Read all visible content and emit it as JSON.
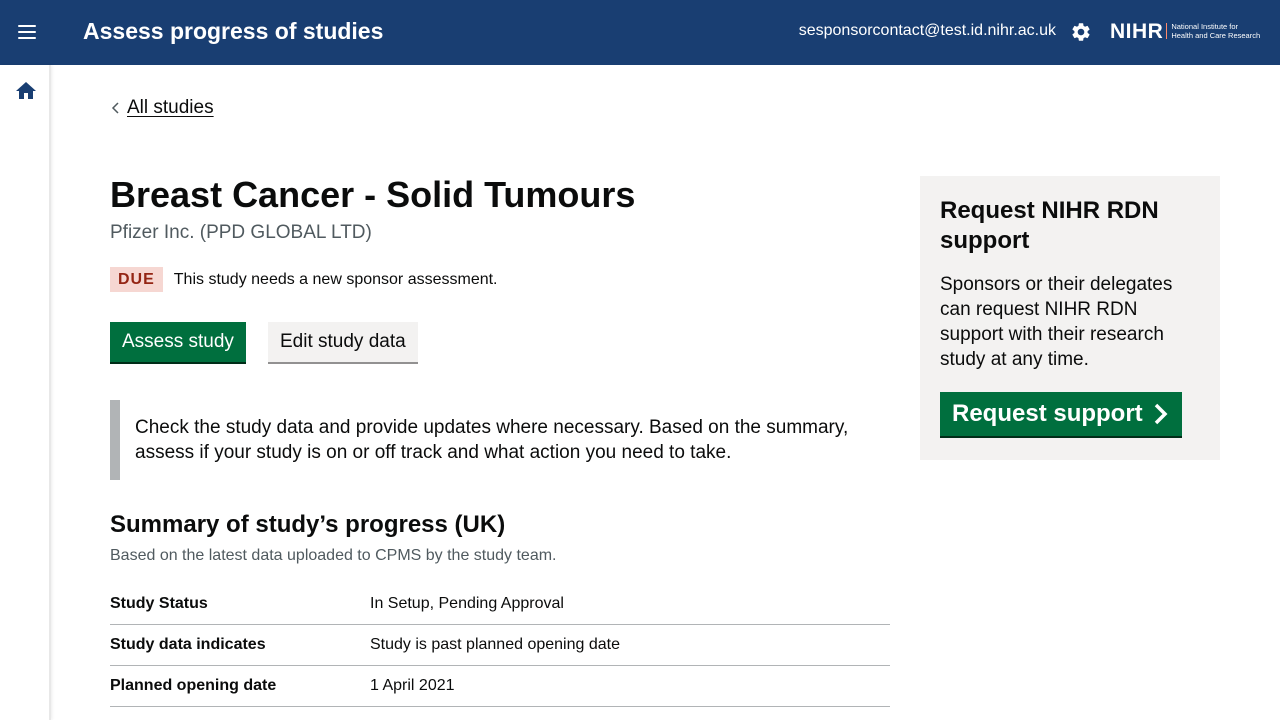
{
  "header": {
    "title": "Assess progress of studies",
    "user_email": "sesponsorcontact@test.id.nihr.ac.uk",
    "logo_mark": "NIHR",
    "logo_line1": "National Institute for",
    "logo_line2": "Health and Care Research"
  },
  "icons": {
    "menu": "menu-icon",
    "settings": "gear-icon",
    "home": "home-icon",
    "back": "chevron-left-icon",
    "start": "chevron-right-icon"
  },
  "nav": {
    "back_label": "All studies"
  },
  "study": {
    "title": "Breast Cancer - Solid Tumours",
    "sponsor": "Pfizer Inc. (PPD GLOBAL LTD)",
    "status_tag": "DUE",
    "status_text": "This study needs a new sponsor assessment."
  },
  "actions": {
    "assess_label": "Assess study",
    "edit_label": "Edit study data"
  },
  "inset_text": "Check the study data and provide updates where necessary. Based on the summary, assess if your study is on or off track and what action you need to take.",
  "summary": {
    "heading": "Summary of study’s progress (UK)",
    "caption": "Based on the latest data uploaded to CPMS by the study team.",
    "rows": [
      {
        "key": "Study Status",
        "value": "In Setup, Pending Approval"
      },
      {
        "key": "Study data indicates",
        "value": "Study is past planned opening date"
      },
      {
        "key": "Planned opening date",
        "value": "1 April 2021"
      }
    ]
  },
  "support_panel": {
    "title": "Request NIHR RDN support",
    "body": "Sponsors or their delegates can request NIHR RDN support with their research study at any time.",
    "button_label": "Request support"
  },
  "colors": {
    "header_bg": "#193e72",
    "primary_button": "#006f3e",
    "tag_bg": "#f6d7d2",
    "tag_text": "#942514",
    "panel_bg": "#f3f2f1"
  }
}
